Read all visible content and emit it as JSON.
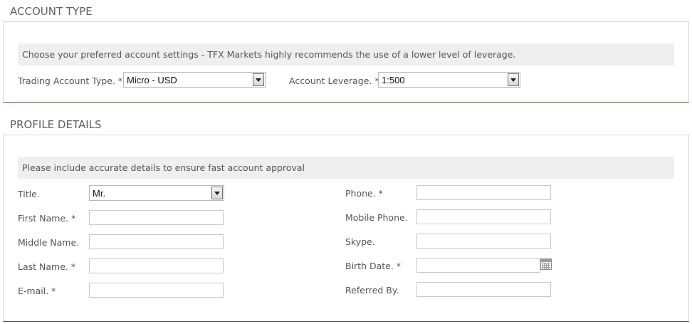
{
  "account_type": {
    "title": "ACCOUNT TYPE",
    "info": "Choose your preferred account settings - TFX Markets highly recommends the use of a lower level of leverage.",
    "trading_account_label": "Trading Account Type. *",
    "trading_account_value": "Micro - USD",
    "leverage_label": "Account Leverage. *",
    "leverage_value": "1:500"
  },
  "profile": {
    "title": "PROFILE DETAILS",
    "info": "Please include accurate details to ensure fast account approval",
    "title_label": "Title.",
    "title_value": "Mr.",
    "first_name_label": "First Name. *",
    "middle_name_label": "Middle Name.",
    "last_name_label": "Last Name. *",
    "email_label": "E-mail. *",
    "phone_label": "Phone. *",
    "mobile_phone_label": "Mobile Phone.",
    "skype_label": "Skype.",
    "birth_date_label": "Birth Date. *",
    "referred_by_label": "Referred By.",
    "first_name_value": "",
    "middle_name_value": "",
    "last_name_value": "",
    "email_value": "",
    "phone_value": "",
    "mobile_phone_value": "",
    "skype_value": "",
    "birth_date_value": "",
    "referred_by_value": ""
  },
  "icons": {
    "calendar": "calendar-icon",
    "dropdown": "chevron-down-icon"
  }
}
